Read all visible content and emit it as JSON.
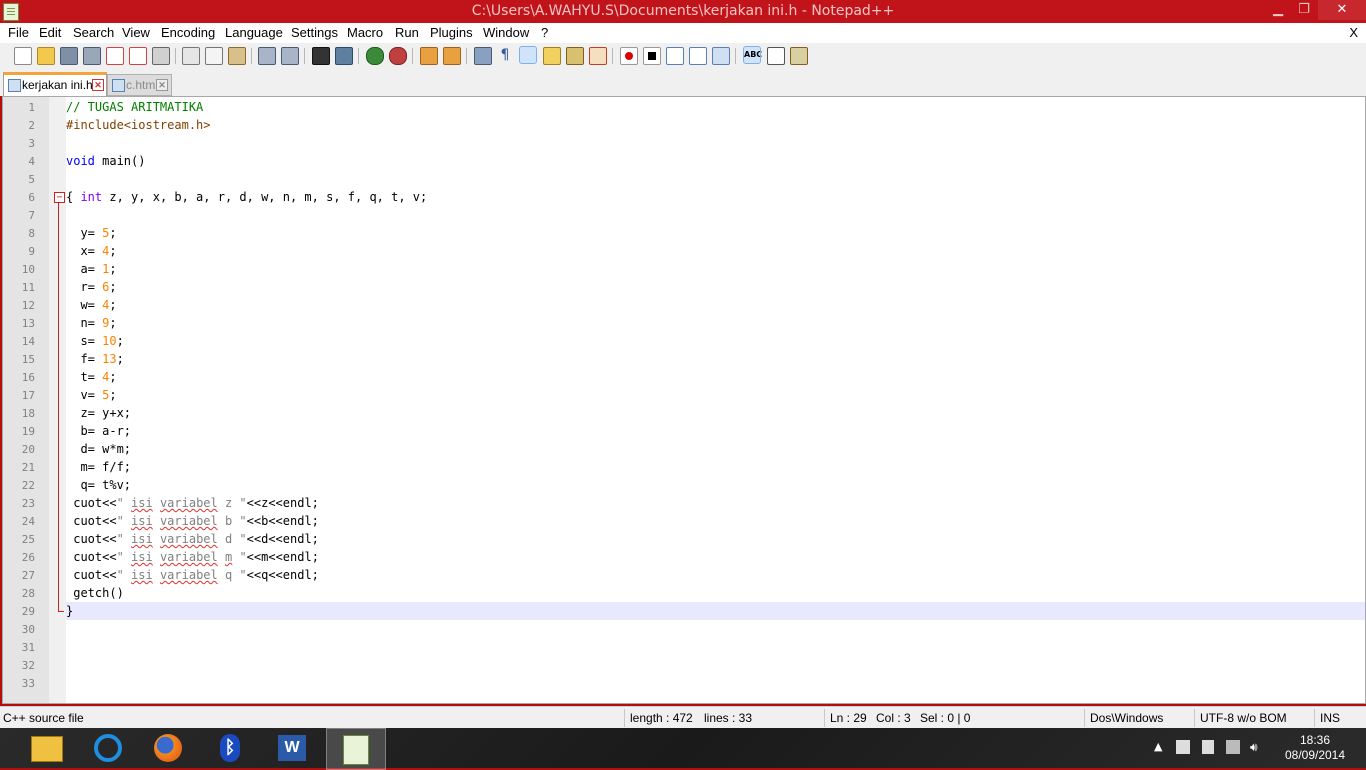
{
  "window": {
    "title": "C:\\Users\\A.WAHYU.S\\Documents\\kerjakan ini.h - Notepad++",
    "minimize_glyph": "▁",
    "maximize_glyph": "❐",
    "close_glyph": "✕",
    "title_bar_color": "#c0141a"
  },
  "menu": {
    "items": [
      "File",
      "Edit",
      "Search",
      "View",
      "Encoding",
      "Language",
      "Settings",
      "Macro",
      "Run",
      "Plugins",
      "Window",
      "?"
    ],
    "close_doc": "X"
  },
  "toolbar": {
    "icons": [
      "new-file-icon",
      "open-file-icon",
      "save-icon",
      "save-all-icon",
      "close-icon",
      "close-all-icon",
      "print-icon",
      "cut-icon",
      "copy-icon",
      "paste-icon",
      "undo-icon",
      "redo-icon",
      "find-icon",
      "replace-icon",
      "zoom-in-icon",
      "zoom-out-icon",
      "sync-vertical-icon",
      "sync-horizontal-icon",
      "word-wrap-icon",
      "show-all-chars-icon",
      "indent-guide-icon",
      "user-lang-icon",
      "doc-map-icon",
      "function-list-icon",
      "record-macro-icon",
      "stop-record-icon",
      "playback-macro-icon",
      "run-macro-multiple-icon",
      "save-macro-icon",
      "spell-check-icon",
      "console-icon",
      "extra-icon"
    ]
  },
  "tabs": [
    {
      "label": "kerjakan ini.h",
      "active": true
    },
    {
      "label": "c.htm",
      "active": false
    }
  ],
  "editor": {
    "lines": [
      [
        [
          "// TUGAS ARITMATIKA",
          "comment"
        ]
      ],
      [
        [
          "#include<iostream.h>",
          "pre"
        ]
      ],
      [],
      [
        [
          "void",
          "kw"
        ],
        [
          " main()",
          "plain"
        ]
      ],
      [],
      [
        [
          "{ ",
          "plain"
        ],
        [
          "int",
          "type"
        ],
        [
          " z, y, x, b, a, r, d, w, n, m, s, f, q, t, v;",
          "plain"
        ]
      ],
      [],
      [
        [
          "  y= ",
          "plain"
        ],
        [
          "5",
          "num"
        ],
        [
          ";",
          "plain"
        ]
      ],
      [
        [
          "  x= ",
          "plain"
        ],
        [
          "4",
          "num"
        ],
        [
          ";",
          "plain"
        ]
      ],
      [
        [
          "  a= ",
          "plain"
        ],
        [
          "1",
          "num"
        ],
        [
          ";",
          "plain"
        ]
      ],
      [
        [
          "  r= ",
          "plain"
        ],
        [
          "6",
          "num"
        ],
        [
          ";",
          "plain"
        ]
      ],
      [
        [
          "  w= ",
          "plain"
        ],
        [
          "4",
          "num"
        ],
        [
          ";",
          "plain"
        ]
      ],
      [
        [
          "  n= ",
          "plain"
        ],
        [
          "9",
          "num"
        ],
        [
          ";",
          "plain"
        ]
      ],
      [
        [
          "  s= ",
          "plain"
        ],
        [
          "10",
          "num"
        ],
        [
          ";",
          "plain"
        ]
      ],
      [
        [
          "  f= ",
          "plain"
        ],
        [
          "13",
          "num"
        ],
        [
          ";",
          "plain"
        ]
      ],
      [
        [
          "  t= ",
          "plain"
        ],
        [
          "4",
          "num"
        ],
        [
          ";",
          "plain"
        ]
      ],
      [
        [
          "  v= ",
          "plain"
        ],
        [
          "5",
          "num"
        ],
        [
          ";",
          "plain"
        ]
      ],
      [
        [
          "  z= y+x;",
          "plain"
        ]
      ],
      [
        [
          "  b= a-r;",
          "plain"
        ]
      ],
      [
        [
          "  d= w*m;",
          "plain"
        ]
      ],
      [
        [
          "  m= f/f;",
          "plain"
        ]
      ],
      [
        [
          "  q= t%v;",
          "plain"
        ]
      ],
      [
        [
          " cuot<<",
          "plain"
        ],
        [
          "\" ",
          "str"
        ],
        [
          "isi",
          "str-sq"
        ],
        [
          " ",
          "str"
        ],
        [
          "variabel",
          "str-sq"
        ],
        [
          " z \"",
          "str"
        ],
        [
          "<<z<<endl;",
          "plain"
        ]
      ],
      [
        [
          " cuot<<",
          "plain"
        ],
        [
          "\" ",
          "str"
        ],
        [
          "isi",
          "str-sq"
        ],
        [
          " ",
          "str"
        ],
        [
          "variabel",
          "str-sq"
        ],
        [
          " b \"",
          "str"
        ],
        [
          "<<b<<endl;",
          "plain"
        ]
      ],
      [
        [
          " cuot<<",
          "plain"
        ],
        [
          "\" ",
          "str"
        ],
        [
          "isi",
          "str-sq"
        ],
        [
          " ",
          "str"
        ],
        [
          "variabel",
          "str-sq"
        ],
        [
          " d \"",
          "str"
        ],
        [
          "<<d<<endl;",
          "plain"
        ]
      ],
      [
        [
          " cuot<<",
          "plain"
        ],
        [
          "\" ",
          "str"
        ],
        [
          "isi",
          "str-sq"
        ],
        [
          " ",
          "str"
        ],
        [
          "variabel",
          "str-sq"
        ],
        [
          " ",
          "str"
        ],
        [
          "m",
          "str-sq"
        ],
        [
          " \"",
          "str"
        ],
        [
          "<<m<<endl;",
          "plain"
        ]
      ],
      [
        [
          " cuot<<",
          "plain"
        ],
        [
          "\" ",
          "str"
        ],
        [
          "isi",
          "str-sq"
        ],
        [
          " ",
          "str"
        ],
        [
          "variabel",
          "str-sq"
        ],
        [
          " q \"",
          "str"
        ],
        [
          "<<q<<endl;",
          "plain"
        ]
      ],
      [
        [
          " getch()",
          "plain"
        ]
      ],
      [
        [
          "}",
          "plain"
        ]
      ],
      [],
      [],
      [],
      []
    ],
    "current_line": 29
  },
  "status": {
    "file_type": "C++ source file",
    "length": "length : 472",
    "lines": "lines : 33",
    "ln": "Ln : 29",
    "col": "Col : 3",
    "sel": "Sel : 0 | 0",
    "eol": "Dos\\Windows",
    "encoding": "UTF-8 w/o BOM",
    "mode": "INS"
  },
  "taskbar": {
    "apps": [
      "file-explorer-icon",
      "internet-explorer-icon",
      "firefox-icon",
      "bluetooth-icon",
      "word-icon",
      "notepadpp-icon"
    ],
    "tray": [
      "show-hidden-icons-icon",
      "action-center-icon",
      "power-icon",
      "network-icon",
      "volume-icon"
    ],
    "time": "18:36",
    "date": "08/09/2014"
  }
}
